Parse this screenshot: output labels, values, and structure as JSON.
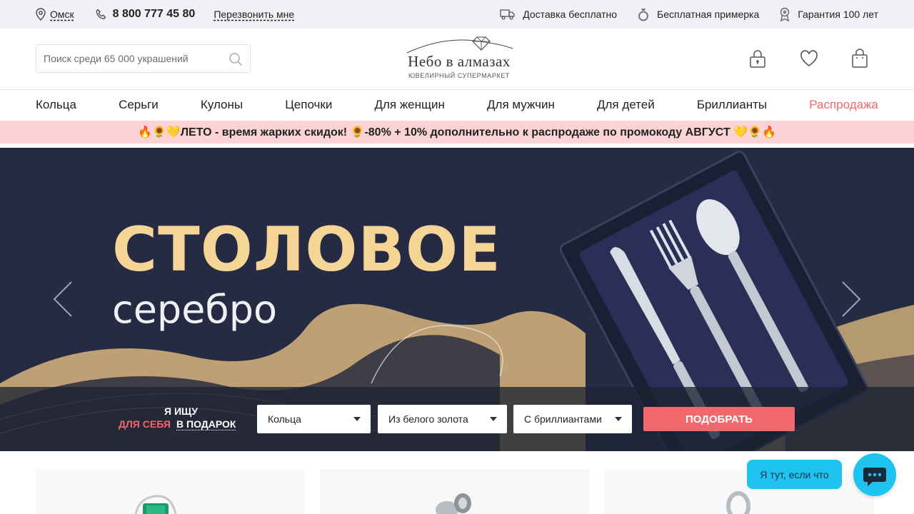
{
  "topbar": {
    "city": "Омск",
    "phone": "8 800 777 45 80",
    "callback": "Перезвонить мне",
    "delivery": "Доставка бесплатно",
    "fitting": "Бесплатная примерка",
    "warranty": "Гарантия 100 лет"
  },
  "header": {
    "search_placeholder": "Поиск среди 65 000 украшений",
    "logo_name": "Небо в алмазах",
    "logo_sub": "ЮВЕЛИРНЫЙ СУПЕРМАРКЕТ",
    "icons": [
      "account-lock-icon",
      "heart-icon",
      "shopping-bag-icon"
    ]
  },
  "nav": {
    "items": [
      "Кольца",
      "Серьги",
      "Кулоны",
      "Цепочки",
      "Для женщин",
      "Для мужчин",
      "Для детей",
      "Бриллианты",
      "Распродажа"
    ]
  },
  "promo": {
    "text": "🔥🌻💛ЛЕТО - время жарких скидок! 🌻-80% + 10% дополнительно к распродаже по промокоду АВГУСТ 💛🌻🔥"
  },
  "hero": {
    "title": "СТОЛОВОЕ",
    "subtitle": "серебро"
  },
  "picker": {
    "looking": "Я ИЩУ",
    "for_self": "ДЛЯ СЕБЯ",
    "as_gift": "В ПОДАРОК",
    "category": "Кольца",
    "material": "Из белого золота",
    "insert": "С бриллиантами",
    "button": "ПОДОБРАТЬ"
  },
  "chat": {
    "bubble": "Я тут, если что"
  },
  "colors": {
    "accent": "#f0676c",
    "promo_bg": "#fbd3d5",
    "hero_bg": "#262b44",
    "gold": "#f5d596",
    "chat": "#1fc3f0"
  }
}
